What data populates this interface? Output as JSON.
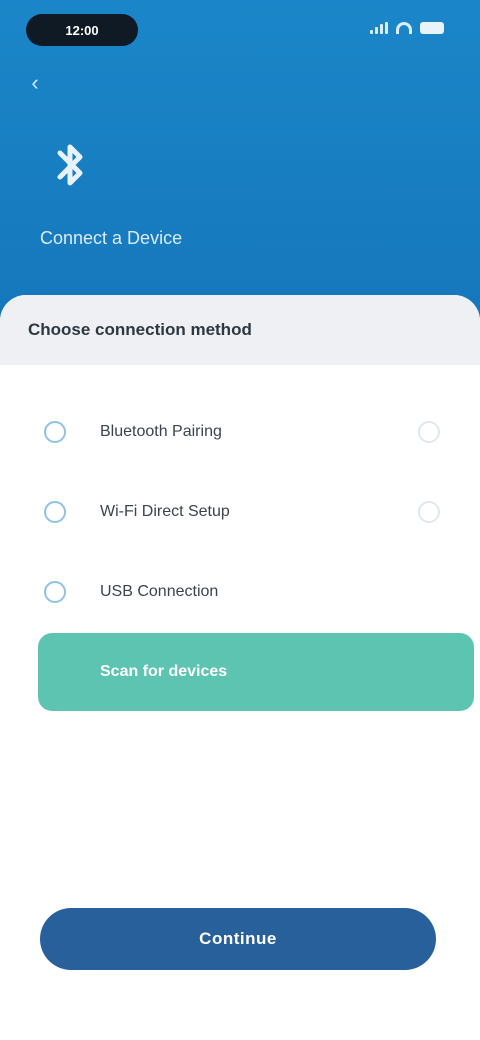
{
  "status_bar": {
    "time": "12:00"
  },
  "header": {
    "title": "Connect a Device"
  },
  "sheet": {
    "title": "Choose connection method",
    "options": [
      {
        "label": "Bluetooth Pairing"
      },
      {
        "label": "Wi-Fi Direct Setup"
      },
      {
        "label": "USB Connection"
      }
    ],
    "green_button_label": "Scan for devices",
    "primary_button_label": "Continue"
  },
  "colors": {
    "header": "#1a86c9",
    "accent_green": "#5ec4b2",
    "primary_button": "#27609a"
  },
  "icons": [
    "back-arrow-icon",
    "bluetooth-icon",
    "radio-icon",
    "check-circle-icon",
    "signal-icon",
    "wifi-icon",
    "battery-icon"
  ]
}
